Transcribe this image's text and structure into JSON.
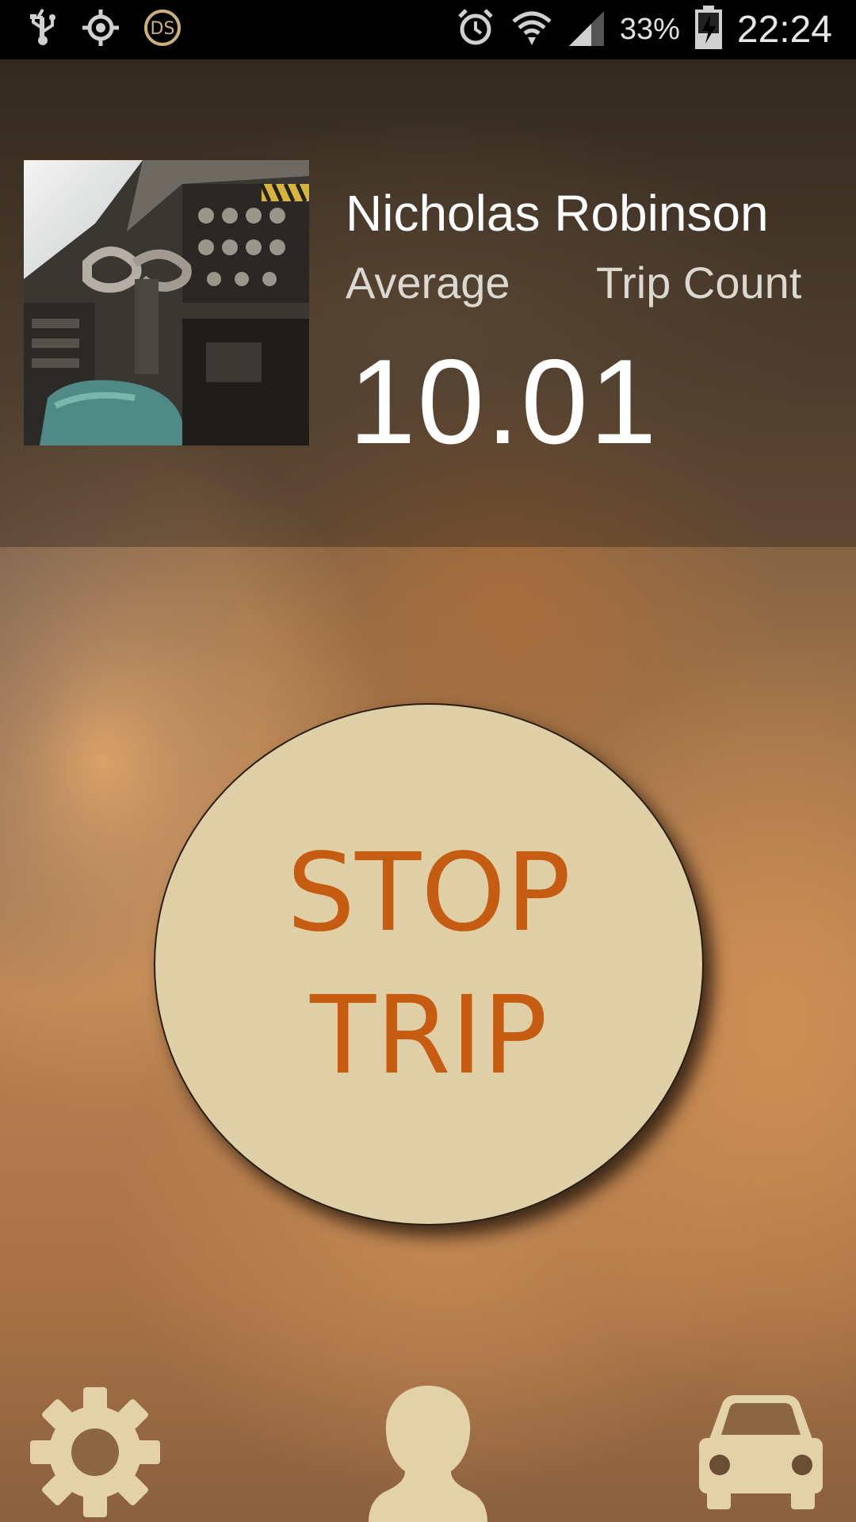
{
  "status_bar": {
    "battery_percent": "33%",
    "time": "22:24",
    "icons": [
      "usb-icon",
      "gps-icon",
      "ds-icon",
      "alarm-icon",
      "wifi-icon",
      "signal-icon",
      "battery-charging-icon"
    ]
  },
  "profile": {
    "name": "Nicholas Robinson",
    "average_label": "Average",
    "trip_count_label": "Trip Count",
    "average_value": "10.01"
  },
  "trip_button": {
    "line1": "STOP",
    "line2": "TRIP"
  },
  "bottom_nav": {
    "items": [
      {
        "icon": "gear-icon"
      },
      {
        "icon": "profile-icon"
      },
      {
        "icon": "car-icon"
      }
    ]
  },
  "colors": {
    "button_fill": "#dfcfa6",
    "button_text": "#c65c12",
    "nav_icon": "#e3d2a8"
  }
}
